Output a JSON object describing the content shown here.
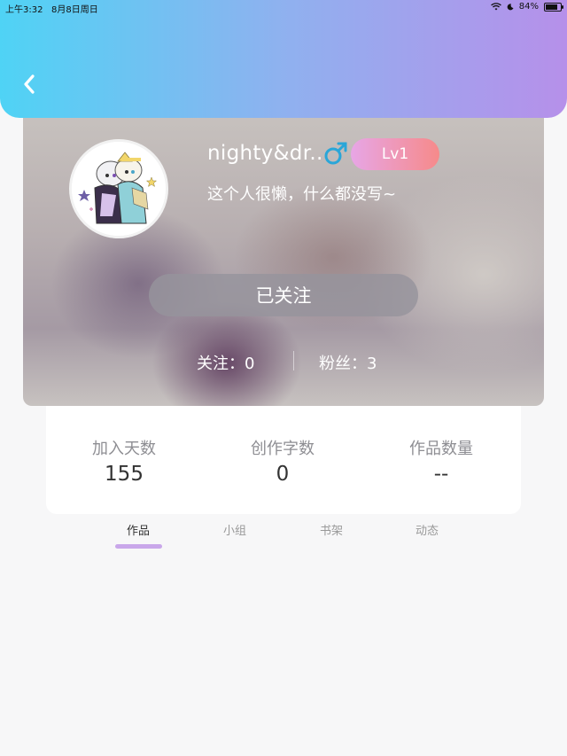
{
  "status_bar": {
    "time": "上午3:32",
    "date": "8月8日周日",
    "battery": "84%",
    "battery_level": 0.84
  },
  "header": {
    "back_icon": "chevron-left-icon"
  },
  "profile": {
    "username": "nighty&dr...",
    "gender_icon": "male-icon",
    "gender_symbol": "♂",
    "gender_color": "#2aa6d8",
    "level": "Lv1",
    "bio": "这个人很懒，什么都没写~",
    "follow_button_label": "已关注",
    "following": "关注：0",
    "fans": "粉丝：3"
  },
  "stats": [
    {
      "label": "加入天数",
      "value": "155"
    },
    {
      "label": "创作字数",
      "value": "0"
    },
    {
      "label": "作品数量",
      "value": "--"
    }
  ],
  "tabs": [
    {
      "label": "作品",
      "active": true
    },
    {
      "label": "小组",
      "active": false
    },
    {
      "label": "书架",
      "active": false
    },
    {
      "label": "动态",
      "active": false
    }
  ],
  "colors": {
    "header_gradient_start": "#4fd3f5",
    "header_gradient_end": "#b690ea",
    "tab_indicator": "#c9a7ea",
    "level_badge_start": "#e7a6e6",
    "level_badge_end": "#f68a8a"
  }
}
